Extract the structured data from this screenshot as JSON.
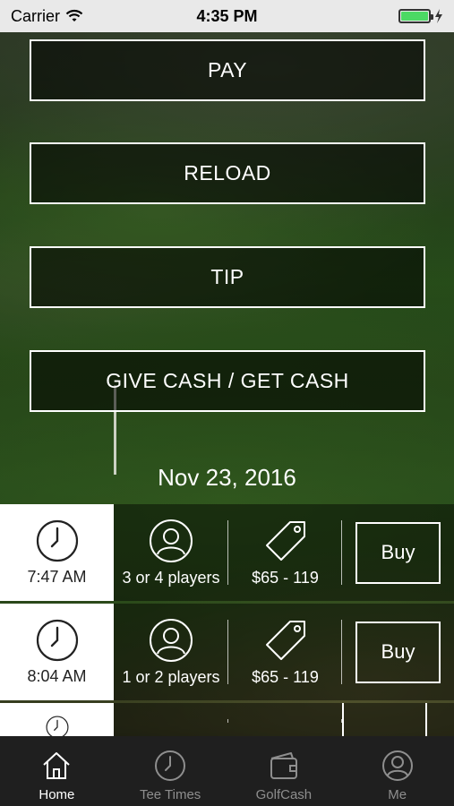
{
  "status_bar": {
    "carrier": "Carrier",
    "time": "4:35 PM"
  },
  "actions": {
    "pay": "PAY",
    "reload": "RELOAD",
    "tip": "TIP",
    "give_get": "GIVE CASH / GET CASH"
  },
  "date": "Nov 23, 2016",
  "tee_times": [
    {
      "time": "7:47 AM",
      "players": "3 or 4 players",
      "price": "$65 - 119",
      "buy_label": "Buy"
    },
    {
      "time": "8:04 AM",
      "players": "1 or 2 players",
      "price": "$65 - 119",
      "buy_label": "Buy"
    },
    {
      "time": "",
      "players": "",
      "price": "",
      "buy_label": ""
    }
  ],
  "tabs": [
    {
      "label": "Home",
      "icon": "home-icon",
      "active": true
    },
    {
      "label": "Tee Times",
      "icon": "clock-icon",
      "active": false
    },
    {
      "label": "GolfCash",
      "icon": "wallet-icon",
      "active": false
    },
    {
      "label": "Me",
      "icon": "user-icon",
      "active": false
    }
  ],
  "colors": {
    "battery": "#4cd964",
    "tab_bar": "#1f1f1f"
  }
}
